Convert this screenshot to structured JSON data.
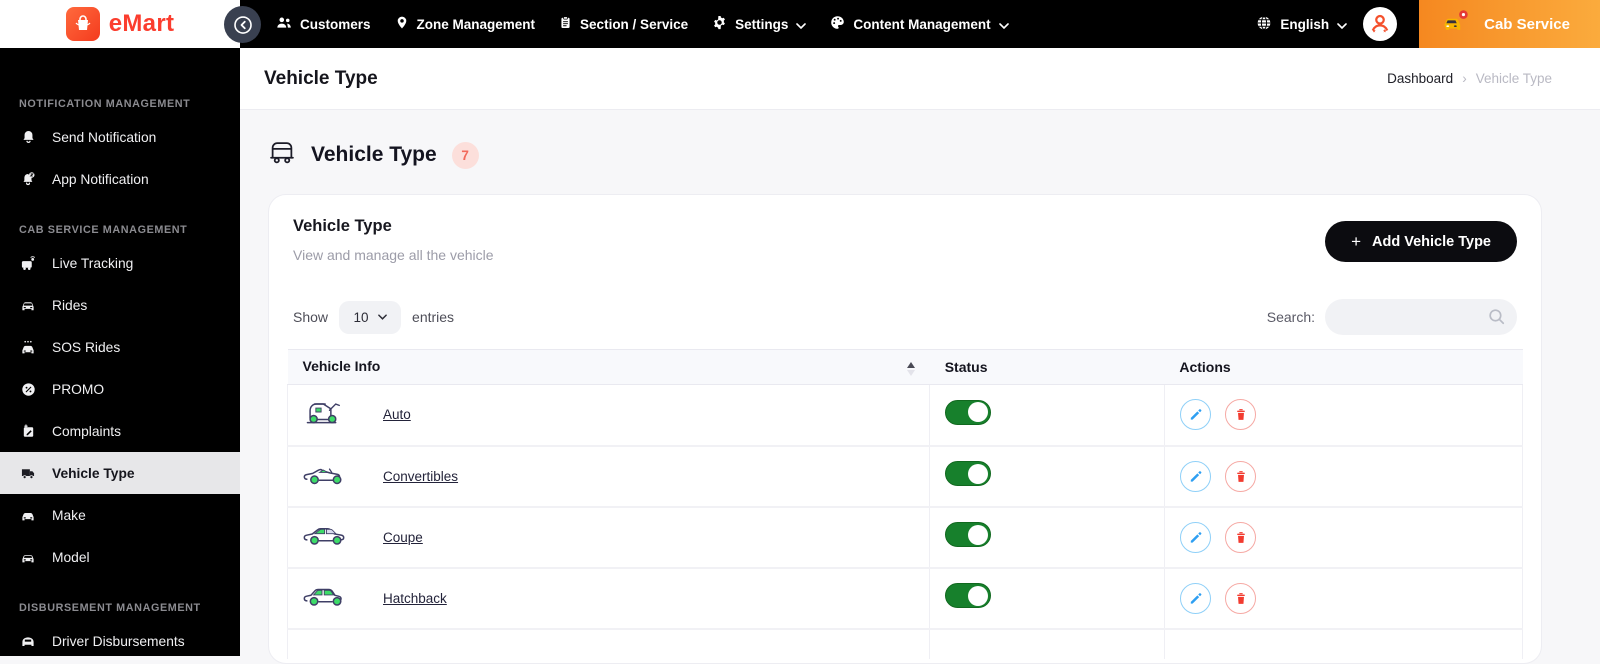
{
  "brand": {
    "name": "eMart"
  },
  "navbar": {
    "items": [
      {
        "label": "Customers"
      },
      {
        "label": "Zone Management"
      },
      {
        "label": "Section / Service"
      },
      {
        "label": "Settings"
      },
      {
        "label": "Content Management"
      }
    ],
    "language": "English",
    "service": "Cab Service"
  },
  "sidebar": {
    "sections": [
      {
        "title": "NOTIFICATION MANAGEMENT",
        "items": [
          {
            "label": "Send Notification"
          },
          {
            "label": "App Notification"
          }
        ]
      },
      {
        "title": "CAB SERVICE MANAGEMENT",
        "items": [
          {
            "label": "Live Tracking"
          },
          {
            "label": "Rides"
          },
          {
            "label": "SOS Rides"
          },
          {
            "label": "PROMO"
          },
          {
            "label": "Complaints"
          },
          {
            "label": "Vehicle Type"
          },
          {
            "label": "Make"
          },
          {
            "label": "Model"
          }
        ]
      },
      {
        "title": "DISBURSEMENT MANAGEMENT",
        "items": [
          {
            "label": "Driver Disbursements"
          }
        ]
      }
    ]
  },
  "topbar": {
    "title": "Vehicle Type",
    "breadcrumb": {
      "home": "Dashboard",
      "separator": "›",
      "current": "Vehicle Type"
    }
  },
  "page": {
    "heading": "Vehicle Type",
    "count": "7"
  },
  "card": {
    "title": "Vehicle Type",
    "subtitle": "View and manage all the vehicle",
    "add_button": {
      "plus": "+",
      "label": "Add Vehicle Type"
    },
    "show_label": "Show",
    "page_size": "10",
    "entries_label": "entries",
    "search_label": "Search:"
  },
  "table": {
    "columns": [
      {
        "label": "Vehicle Info"
      },
      {
        "label": "Status"
      },
      {
        "label": "Actions"
      }
    ],
    "rows": [
      {
        "name": "Auto",
        "vehicle_icon": "auto-rickshaw-illustration",
        "status": "on"
      },
      {
        "name": "Convertibles",
        "vehicle_icon": "convertible-illustration",
        "status": "on"
      },
      {
        "name": "Coupe",
        "vehicle_icon": "coupe-illustration",
        "status": "on"
      },
      {
        "name": "Hatchback",
        "vehicle_icon": "hatchback-illustration",
        "status": "on"
      }
    ]
  },
  "colors": {
    "navbar_bg": "#000000",
    "brand_red": "#fb3d2e",
    "cab_gradient_start": "#f58820",
    "cab_gradient_end": "#fbab3d",
    "active_item_bg": "#e7e7e9",
    "toggle_green": "#17802c",
    "edit_blue": "#2e9ff2",
    "delete_red": "#f23b2f",
    "badge_bg": "#fcdfdb",
    "badge_text": "#f2695b"
  }
}
